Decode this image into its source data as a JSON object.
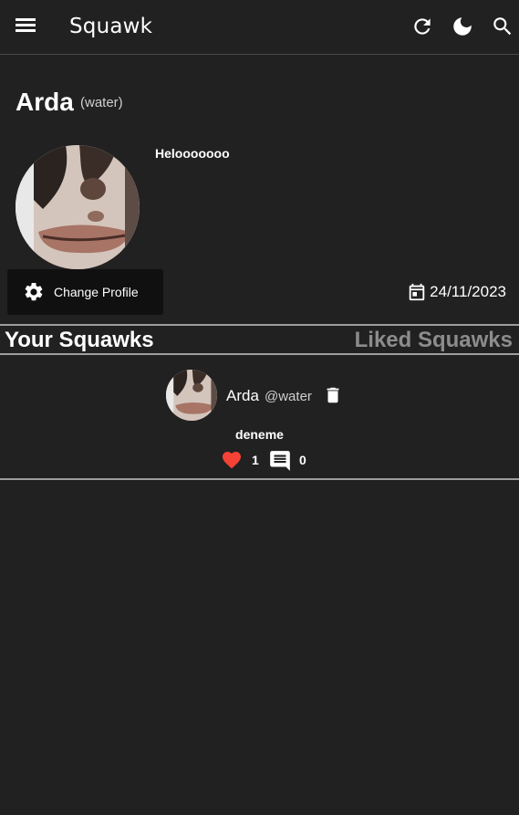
{
  "app": {
    "title": "Squawk"
  },
  "profile": {
    "name": "Arda",
    "handle": "(water)",
    "bio": "Helooooooo",
    "change_profile_label": "Change Profile",
    "joined_date": "24/11/2023"
  },
  "tabs": [
    {
      "label": "Your Squawks",
      "active": true
    },
    {
      "label": "Liked Squawks",
      "active": false
    }
  ],
  "posts": [
    {
      "author": "Arda",
      "handle": "@water",
      "text": "deneme",
      "likes": "1",
      "comments": "0"
    }
  ],
  "icons": [
    "menu-icon",
    "refresh-icon",
    "moon-icon",
    "search-icon",
    "gear-icon",
    "calendar-icon",
    "trash-icon",
    "heart-icon",
    "comment-icon"
  ],
  "colors": {
    "background": "#212121",
    "like": "#f44336",
    "inactive_tab": "#8c8c8c"
  }
}
